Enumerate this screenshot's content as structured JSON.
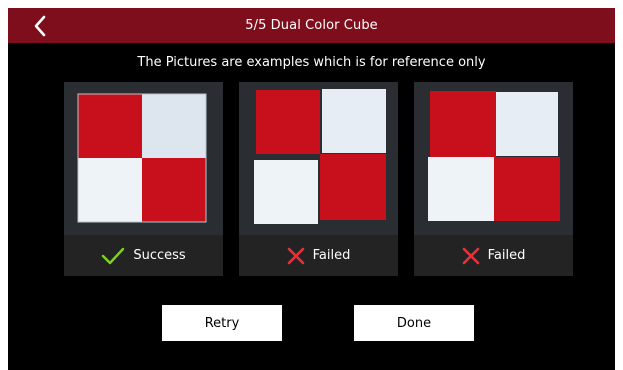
{
  "header": {
    "title": "5/5 Dual Color Cube"
  },
  "subtitle": "The Pictures are examples which is for reference only",
  "examples": [
    {
      "label": "Success",
      "status": "success"
    },
    {
      "label": "Failed",
      "status": "failed"
    },
    {
      "label": "Failed",
      "status": "failed"
    }
  ],
  "buttons": {
    "retry": "Retry",
    "done": "Done"
  },
  "icons": {
    "back": "chevron-left-icon",
    "success": "check-icon",
    "failed": "x-icon"
  },
  "colors": {
    "header": "#7e0e1c",
    "background": "#000000",
    "success": "#7ed321",
    "failed": "#e8303a",
    "cube_red": "#c8101c",
    "cube_white": "#eef3f8"
  }
}
